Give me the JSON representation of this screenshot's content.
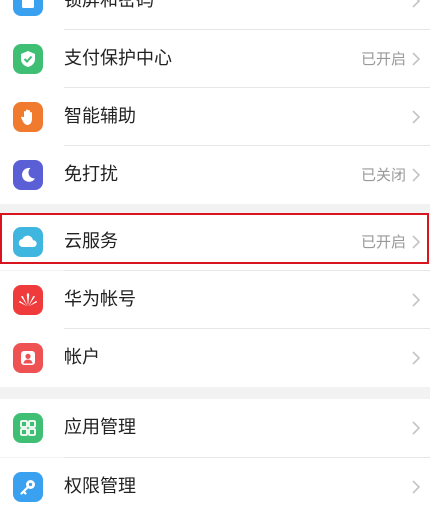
{
  "settings": {
    "items": [
      {
        "label": "锁屏和密码",
        "status": "",
        "icon": "lock-screen-icon",
        "color": "#3aa0f0"
      },
      {
        "label": "支付保护中心",
        "status": "已开启",
        "icon": "shield-check-icon",
        "color": "#3fbf73"
      },
      {
        "label": "智能辅助",
        "status": "",
        "icon": "hand-icon",
        "color": "#f07a2e"
      },
      {
        "label": "免打扰",
        "status": "已关闭",
        "icon": "moon-icon",
        "color": "#5b5fd6"
      },
      {
        "label": "云服务",
        "status": "已开启",
        "icon": "cloud-icon",
        "color": "#3fb6e0"
      },
      {
        "label": "华为帐号",
        "status": "",
        "icon": "huawei-logo-icon",
        "color": "#ef3b3b"
      },
      {
        "label": "帐户",
        "status": "",
        "icon": "person-icon",
        "color": "#ef5252"
      },
      {
        "label": "应用管理",
        "status": "",
        "icon": "grid-apps-icon",
        "color": "#3fbf73"
      },
      {
        "label": "权限管理",
        "status": "",
        "icon": "key-icon",
        "color": "#3aa0f0"
      }
    ]
  }
}
